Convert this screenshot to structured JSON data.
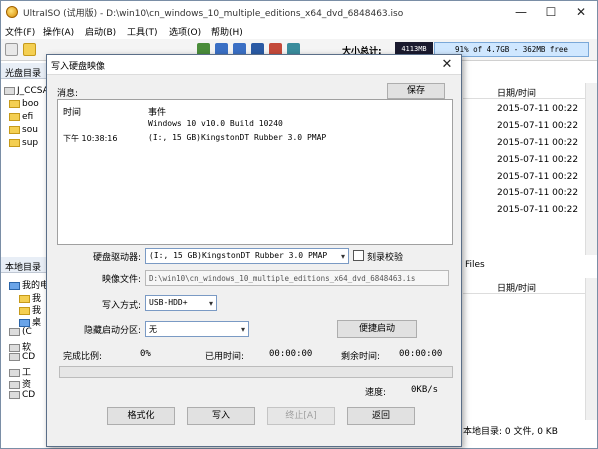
{
  "window": {
    "title": "UltraISO (试用版) - D:\\win10\\cn_windows_10_multiple_editions_x64_dvd_6848463.iso",
    "minimize_glyph": "—",
    "maximize_glyph": "☐",
    "close_glyph": "✕"
  },
  "menu": [
    "文件(F)",
    "操作(A)",
    "启动(B)",
    "工具(T)",
    "选项(O)",
    "帮助(H)"
  ],
  "toolbar": {
    "size_label": "大小总计:",
    "size_value": "4113MB",
    "capacity_text": "91% of 4.7GB - 362MB free",
    "capacity_percent": 91
  },
  "cd_pane": {
    "title": "光盘目录",
    "root": "J_CCSA",
    "items": [
      "boo",
      "efi",
      "sou",
      "sup"
    ]
  },
  "local_pane": {
    "title": "本地目录",
    "items": [
      "我的电",
      "我",
      "我",
      "桌",
      "(C",
      "软",
      "CD",
      "工",
      "资",
      "CD"
    ]
  },
  "right_top": {
    "column": "日期/时间",
    "rows": [
      "2015-07-11 00:22",
      "2015-07-11 00:22",
      "2015-07-11 00:22",
      "2015-07-11 00:22",
      "2015-07-11 00:22",
      "2015-07-11 00:22",
      "2015-07-11 00:22"
    ]
  },
  "right_bottom": {
    "tab": "Files",
    "column": "日期/时间",
    "status": "本地目录: 0 文件, 0 KB"
  },
  "dialog": {
    "title": "写入硬盘映像",
    "close_glyph": "✕",
    "message_label": "消息:",
    "save_button": "保存",
    "log_headers": {
      "time": "时间",
      "event": "事件"
    },
    "log_rows": [
      {
        "time": "",
        "event": "Windows 10 v10.0 Build 10240"
      },
      {
        "time": "下午 10:38:16",
        "event": "(I:, 15 GB)KingstonDT Rubber 3.0    PMAP"
      }
    ],
    "drive_label": "硬盘驱动器:",
    "drive_value": "(I:, 15 GB)KingstonDT Rubber 3.0    PMAP",
    "verify_label": "刻录校验",
    "image_label": "映像文件:",
    "image_value": "D:\\win10\\cn_windows_10_multiple_editions_x64_dvd_6848463.is",
    "write_mode_label": "写入方式:",
    "write_mode_value": "USB-HDD+",
    "hide_partition_label": "隐藏启动分区:",
    "hide_partition_value": "无",
    "convenient_boot_button": "便捷启动",
    "progress_label": "完成比例:",
    "progress_value": "0%",
    "progress_fraction": 0,
    "elapsed_label": "已用时间:",
    "elapsed_value": "00:00:00",
    "remaining_label": "剩余时间:",
    "remaining_value": "00:00:00",
    "speed_label": "速度:",
    "speed_value": "0KB/s",
    "buttons": {
      "format": "格式化",
      "write": "写入",
      "stop": "终止[A]",
      "back": "返回"
    }
  }
}
